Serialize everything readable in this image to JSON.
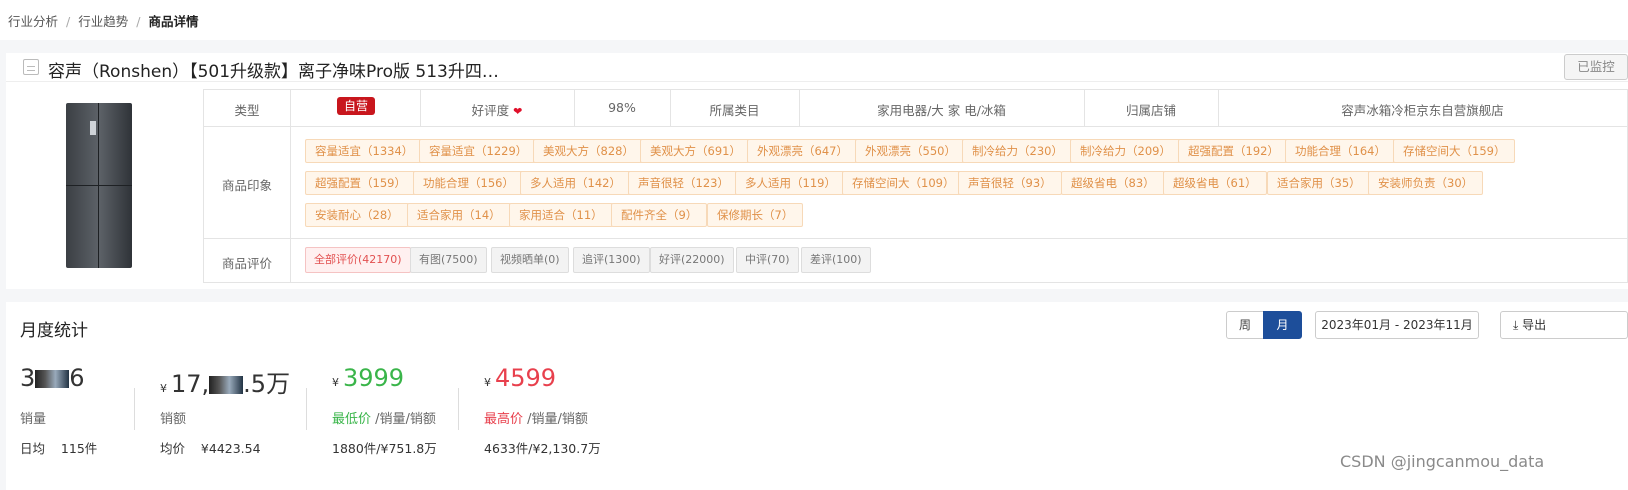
{
  "breadcrumb": [
    "行业分析",
    "行业趋势",
    "商品详情"
  ],
  "product": {
    "title": "容声（Ronshen）【501升级款】离子净味Pro版 513升四…",
    "monitor_label": "已监控",
    "labels": {
      "type": "类型",
      "impression": "商品印象",
      "review": "商品评价"
    },
    "type_badge": "自营",
    "favor_label": "好评度",
    "favor_value": "98%",
    "category_label": "所属类目",
    "category_value": "家用电器/大 家 电/冰箱",
    "shop_label": "归属店铺",
    "shop_value": "容声冰箱冷柜京东自营旗舰店",
    "impression_tags": [
      "容量适宜（1334）",
      "容量适宜（1229）",
      "美观大方（828）",
      "美观大方（691）",
      "外观漂亮（647）",
      "外观漂亮（550）",
      "制冷给力（230）",
      "制冷给力（209）",
      "超强配置（192）",
      "功能合理（164）",
      "存储空间大（159）",
      "超强配置（159）",
      "功能合理（156）",
      "多人适用（142）",
      "声音很轻（123）",
      "多人适用（119）",
      "存储空间大（109）",
      "声音很轻（93）",
      "超级省电（83）",
      "超级省电（61）",
      "适合家用（35）",
      "安装师负责（30）",
      "安装耐心（28）",
      "适合家用（14）",
      "家用适合（11）",
      "配件齐全（9）",
      "保修期长（7）"
    ],
    "review_tags": [
      "全部评价(42170)",
      "有图(7500)",
      "视频晒单(0)",
      "追评(1300)",
      "好评(22000)",
      "中评(70)",
      "差评(100)"
    ]
  },
  "monthly": {
    "title": "月度统计",
    "week_label": "周",
    "month_label": "月",
    "date_range": "2023年01月 - 2023年11月",
    "export_label": "导出",
    "sales": {
      "value_start": "3",
      "value_end": "6",
      "label": "销量",
      "avg_label": "日均",
      "avg_value": "115件"
    },
    "revenue": {
      "currency": "¥",
      "value_start": "17,",
      "value_end": ".5万",
      "label": "销额",
      "avg_label": "均价",
      "avg_value": "¥4423.54"
    },
    "min_price": {
      "currency": "¥",
      "value": "3999",
      "label": "最低价",
      "label_suffix": "/销量/销额",
      "detail": "1880件/¥751.8万"
    },
    "max_price": {
      "currency": "¥",
      "value": "4599",
      "label": "最高价",
      "label_suffix": "/销量/销额",
      "detail": "4633件/¥2,130.7万"
    }
  },
  "watermark": "CSDN @jingcanmou_data",
  "colors": {
    "self_badge": "#c8161d",
    "active_tab": "#1d4e9a",
    "min_price": "#3ab54a",
    "max_price": "#e8404d",
    "tag_text": "#e09149"
  }
}
